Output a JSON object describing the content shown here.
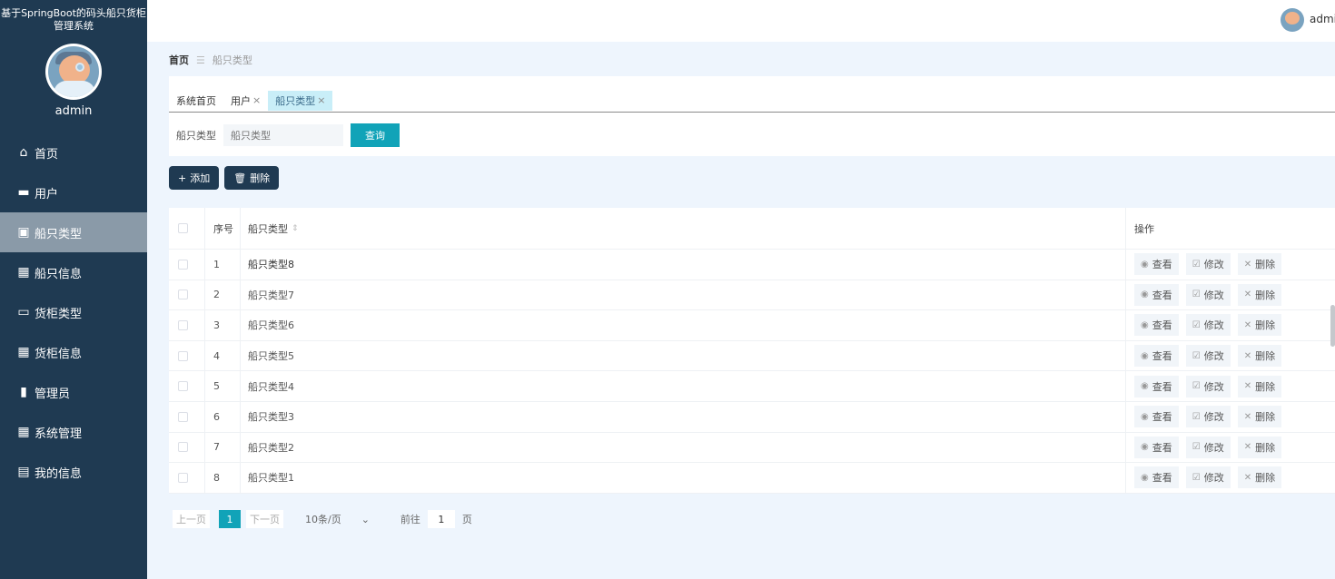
{
  "sidebar": {
    "system_title": "基于SpringBoot的码头船只货柜管理系统",
    "user_name": "admin",
    "items": [
      {
        "label": "首页",
        "icon": "home-icon",
        "glyph": "⌂",
        "active": false
      },
      {
        "label": "用户",
        "icon": "briefcase-icon",
        "glyph": "▬",
        "active": false
      },
      {
        "label": "船只类型",
        "icon": "chart-icon",
        "glyph": "▣",
        "active": true
      },
      {
        "label": "船只信息",
        "icon": "grid-icon",
        "glyph": "▦",
        "active": false
      },
      {
        "label": "货柜类型",
        "icon": "chat-icon",
        "glyph": "▭",
        "active": false
      },
      {
        "label": "货柜信息",
        "icon": "grid-icon",
        "glyph": "▦",
        "active": false
      },
      {
        "label": "管理员",
        "icon": "bar-chart-icon",
        "glyph": "▮",
        "active": false
      },
      {
        "label": "系统管理",
        "icon": "grid-icon",
        "glyph": "▦",
        "active": false
      },
      {
        "label": "我的信息",
        "icon": "wallet-icon",
        "glyph": "▤",
        "active": false
      }
    ]
  },
  "header": {
    "user_name": "admin"
  },
  "breadcrumb": {
    "home": "首页",
    "separator": "☰",
    "current": "船只类型"
  },
  "tabs": [
    {
      "label": "系统首页",
      "closable": false,
      "active": false
    },
    {
      "label": "用户",
      "closable": true,
      "active": false
    },
    {
      "label": "船只类型",
      "closable": true,
      "active": true
    }
  ],
  "search": {
    "label": "船只类型",
    "placeholder": "船只类型",
    "button": "查询"
  },
  "toolbar": {
    "add_label": "添加",
    "delete_label": "删除"
  },
  "table": {
    "columns": {
      "index": "序号",
      "name": "船只类型",
      "ops": "操作"
    },
    "rows": [
      {
        "index": "1",
        "name": "船只类型8"
      },
      {
        "index": "2",
        "name": "船只类型7"
      },
      {
        "index": "3",
        "name": "船只类型6"
      },
      {
        "index": "4",
        "name": "船只类型5"
      },
      {
        "index": "5",
        "name": "船只类型4"
      },
      {
        "index": "6",
        "name": "船只类型3"
      },
      {
        "index": "7",
        "name": "船只类型2"
      },
      {
        "index": "8",
        "name": "船只类型1"
      }
    ],
    "ops": {
      "view": "查看",
      "edit": "修改",
      "delete": "删除"
    }
  },
  "pager": {
    "prev": "上一页",
    "current": "1",
    "next": "下一页",
    "page_size": "10条/页",
    "goto_prefix": "前往",
    "goto_value": "1",
    "goto_suffix": "页"
  },
  "colors": {
    "sidebar": "#1f3a52",
    "accent": "#11a3b8",
    "active_menu": "#8a9aa8",
    "active_tab": "#c9eef8"
  }
}
